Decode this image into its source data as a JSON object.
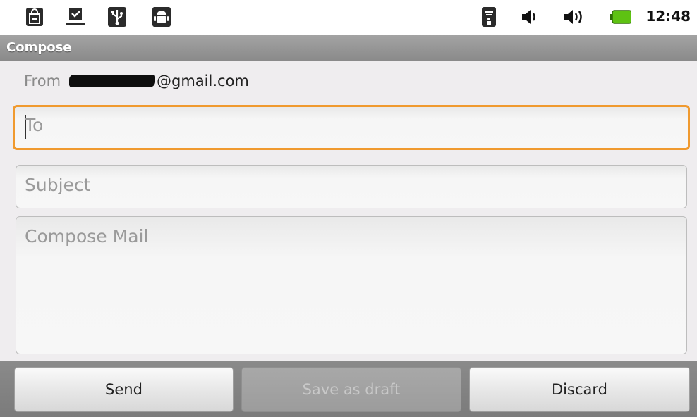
{
  "status_bar": {
    "icons": [
      "shopping-bag-icon",
      "download-done-icon",
      "usb-icon",
      "android-icon",
      "wifi-icon",
      "volume-icon",
      "volume-high-icon",
      "battery-icon"
    ],
    "time": "12:48"
  },
  "title_bar": {
    "title": "Compose"
  },
  "compose": {
    "from_label": "From",
    "from_domain": "@gmail.com",
    "to_placeholder": "To",
    "subject_placeholder": "Subject",
    "body_placeholder": "Compose Mail"
  },
  "actions": {
    "send": "Send",
    "save_draft": "Save as draft",
    "discard": "Discard"
  },
  "colors": {
    "focus_accent": "#f09a2f",
    "battery_green": "#5ec212"
  }
}
